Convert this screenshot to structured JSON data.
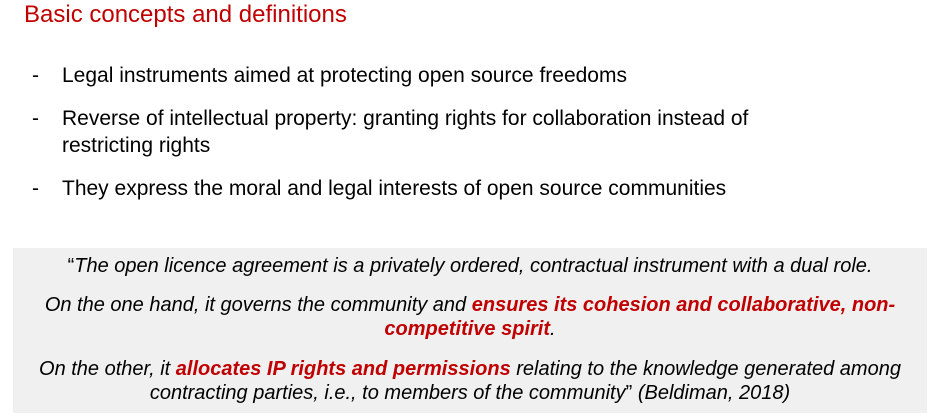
{
  "title": "Basic concepts and definitions",
  "bullets": [
    {
      "dash": "-",
      "text": "Legal instruments aimed at protecting open source freedoms"
    },
    {
      "dash": "-",
      "text": "Reverse of intellectual property: granting rights for collaboration instead of restricting rights"
    },
    {
      "dash": "-",
      "text": "They express the moral and legal interests of open source communities"
    }
  ],
  "quote": {
    "open_mark": "“",
    "line1": "The open licence agreement is a privately ordered, contractual instrument with a dual role.",
    "line2_pre": "On the one hand, it governs the community and ",
    "line2_highlight": "ensures its cohesion and collaborative, non-competitive spirit",
    "line2_post": ".",
    "line3_pre": "On the other, it ",
    "line3_highlight": "allocates IP rights and permissions",
    "line3_post": " relating to the knowledge generated among contracting parties, i.e., to members of the community",
    "close_mark": "”",
    "citation": " (Beldiman, 2018)"
  },
  "colors": {
    "accent": "#c00000",
    "quote_bg": "#f0f0f0"
  }
}
